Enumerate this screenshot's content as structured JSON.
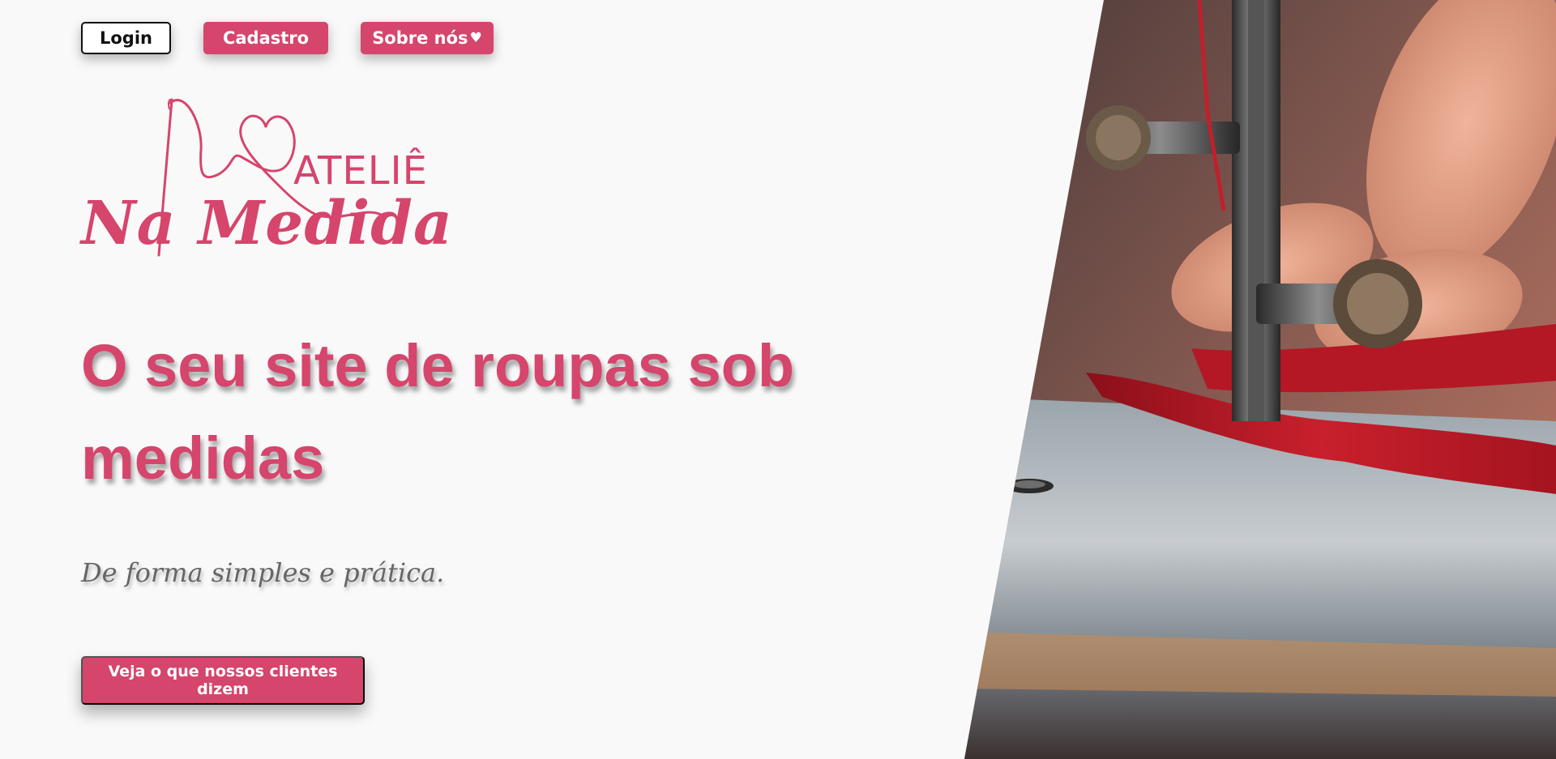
{
  "nav": {
    "login_label": "Login",
    "signup_label": "Cadastro",
    "about_label": "Sobre nós"
  },
  "logo": {
    "top_text": "ATELIÊ",
    "main_text": "Na Medida"
  },
  "hero": {
    "headline": "O seu site de roupas sob medidas",
    "tagline": "De forma simples e prática.",
    "cta_label": "Veja o que nossos clientes dizem"
  },
  "colors": {
    "brand_pink": "#d5456c",
    "background": "#f9f9f9",
    "tagline_gray": "#666666"
  },
  "icons": {
    "about_heart": "heart-icon",
    "logo_heart": "heart-icon"
  }
}
